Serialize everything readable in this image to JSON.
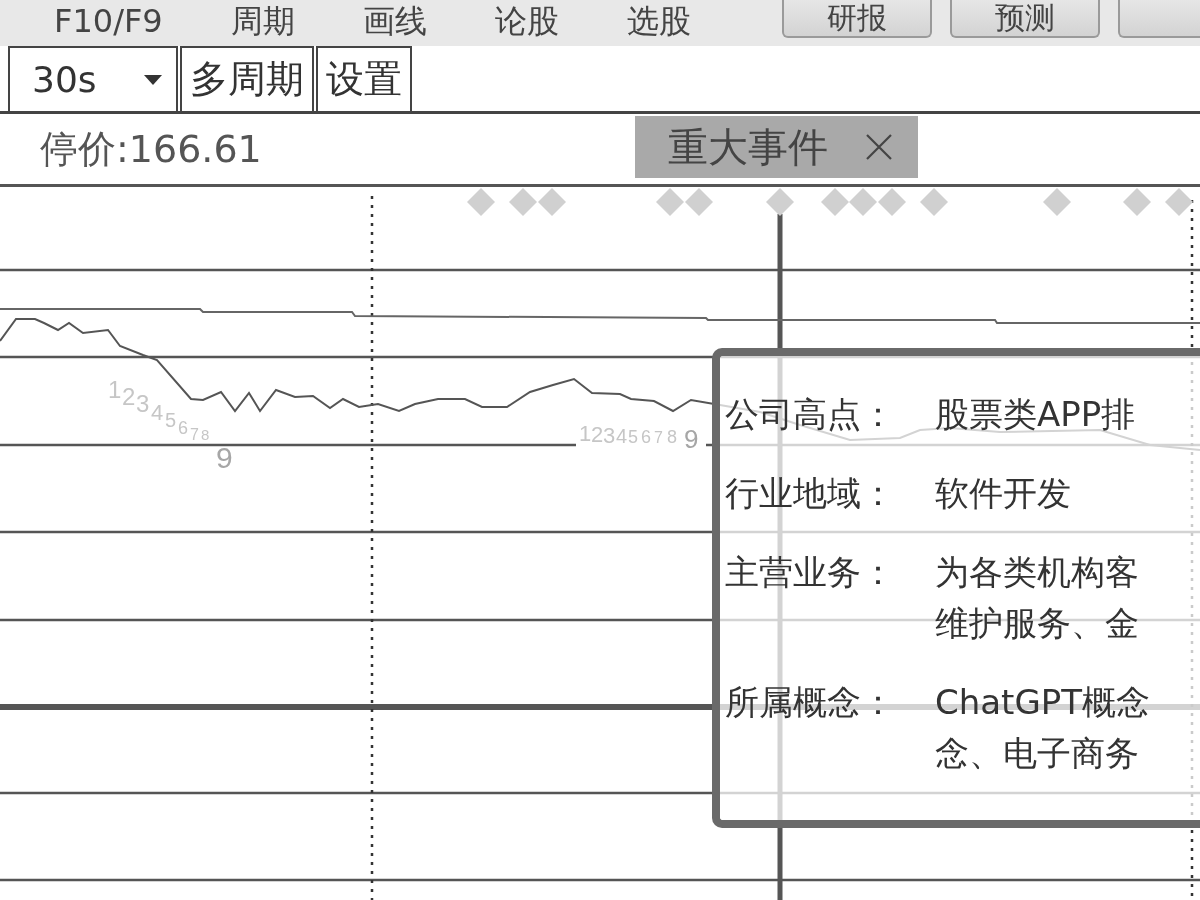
{
  "menu_bar": {
    "items": [
      "F10/F9",
      "周期",
      "画线",
      "论股",
      "选股"
    ],
    "buttons": [
      "研报",
      "预测"
    ]
  },
  "toolbar": {
    "period_dropdown": {
      "value": "30s"
    },
    "buttons": [
      "多周期",
      "设置"
    ]
  },
  "info_bar": {
    "price_text": "停价:166.61",
    "event_tab": {
      "label": "重大事件"
    }
  },
  "chart": {
    "sequence_labels": [
      "123456789",
      "123456789"
    ]
  },
  "tooltip": {
    "rows": [
      {
        "label": "公司高点：",
        "lines": [
          "股票类APP排"
        ]
      },
      {
        "label": "行业地域：",
        "lines": [
          "软件开发"
        ]
      },
      {
        "label": "主营业务：",
        "lines": [
          "为各类机构客",
          "维护服务、金"
        ]
      },
      {
        "label": "所属概念：",
        "lines": [
          "ChatGPT概念",
          "念、电子商务"
        ]
      }
    ]
  }
}
